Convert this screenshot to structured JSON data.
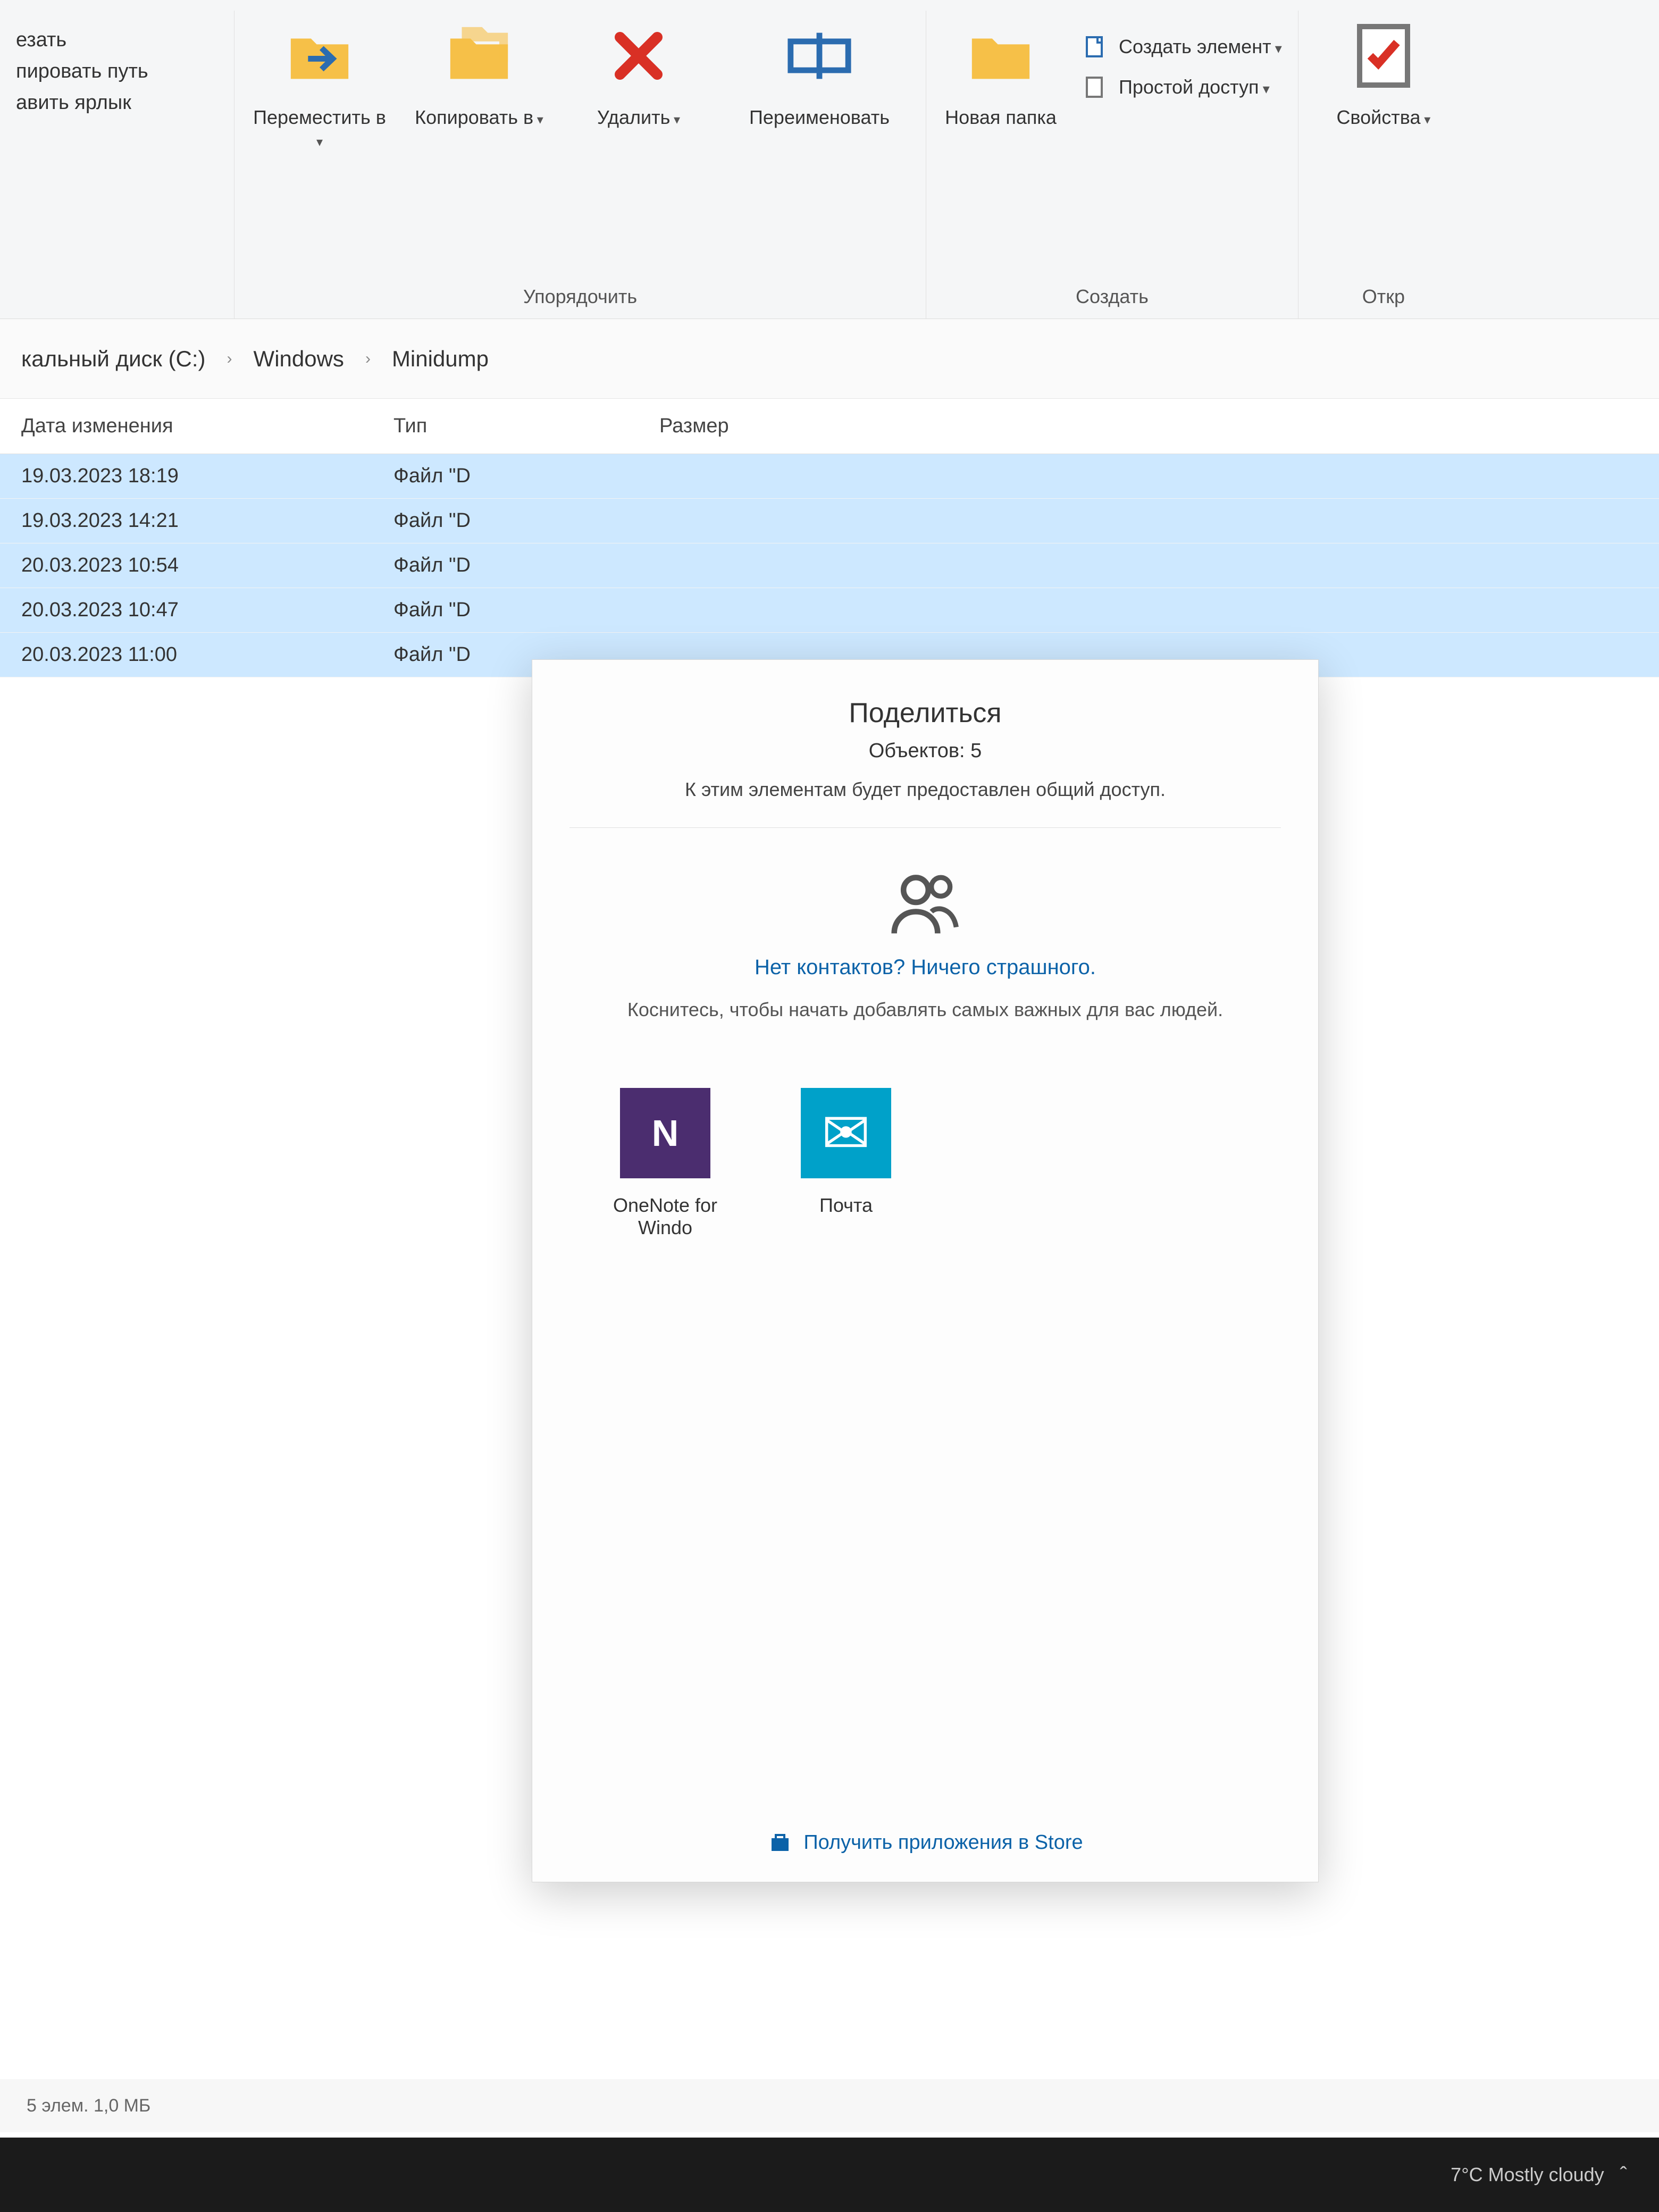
{
  "ribbon": {
    "clipboard": {
      "cut": "езать",
      "copy_path": "пировать путь",
      "paste_shortcut": "авить ярлык"
    },
    "organize": {
      "move_to": "Переместить в",
      "copy_to": "Копировать в",
      "delete": "Удалить",
      "rename": "Переименовать",
      "group_label": "Упорядочить"
    },
    "new": {
      "new_folder": "Новая папка",
      "new_item": "Создать элемент",
      "easy_access": "Простой доступ",
      "group_label": "Создать"
    },
    "open": {
      "properties": "Свойства",
      "group_label": "Откр"
    }
  },
  "breadcrumb": {
    "drive": "кальный диск (C:)",
    "folder1": "Windows",
    "folder2": "Minidump"
  },
  "columns": {
    "date": "Дата изменения",
    "type": "Тип",
    "size": "Размер"
  },
  "rows": [
    {
      "date": "19.03.2023 18:19",
      "type": "Файл \"D"
    },
    {
      "date": "19.03.2023 14:21",
      "type": "Файл \"D"
    },
    {
      "date": "20.03.2023 10:54",
      "type": "Файл \"D"
    },
    {
      "date": "20.03.2023 10:47",
      "type": "Файл \"D"
    },
    {
      "date": "20.03.2023 11:00",
      "type": "Файл \"D"
    }
  ],
  "share": {
    "title": "Поделиться",
    "count_label": "Объектов: 5",
    "desc": "К этим элементам будет предоставлен общий доступ.",
    "no_contacts_title": "Нет контактов? Ничего страшного.",
    "no_contacts_hint": "Коснитесь, чтобы начать добавлять самых важных для вас людей.",
    "apps": [
      {
        "name": "OneNote for Windo"
      },
      {
        "name": "Почта"
      }
    ],
    "store_link": "Получить приложения в Store"
  },
  "statusbar": {
    "text": "5 элем.   1,0 МБ"
  },
  "taskbar": {
    "weather": "7°C  Mostly cloudy"
  }
}
